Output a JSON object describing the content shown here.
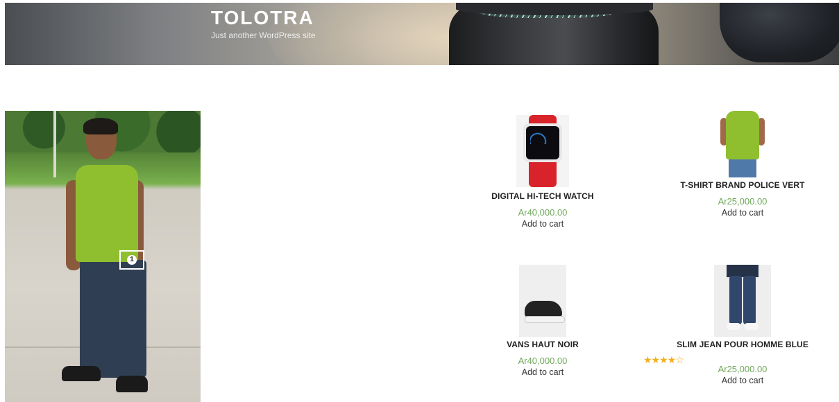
{
  "site": {
    "title": "TOLOTRA",
    "description": "Just another WordPress site"
  },
  "lookbook": {
    "hotspot_number": "1"
  },
  "products": [
    {
      "name": "DIGITAL HI-TECH WATCH",
      "price": "Ar40,000.00",
      "cart_label": "Add to cart",
      "image_icon": "watch-icon"
    },
    {
      "name": "T-SHIRT BRAND POLICE VERT",
      "price": "Ar25,000.00",
      "cart_label": "Add to cart",
      "image_icon": "tshirt-icon"
    },
    {
      "name": "VANS HAUT NOIR",
      "price": "Ar40,000.00",
      "cart_label": "Add to cart",
      "image_icon": "sneaker-icon"
    },
    {
      "name": "SLIM JEAN POUR HOMME BLUE",
      "price": "Ar25,000.00",
      "cart_label": "Add to cart",
      "image_icon": "jeans-icon",
      "rating": {
        "value": 4,
        "max": 5,
        "symbols": "★★★★☆"
      }
    }
  ],
  "colors": {
    "price": "#6fa85a",
    "star": "#f2b01e"
  }
}
